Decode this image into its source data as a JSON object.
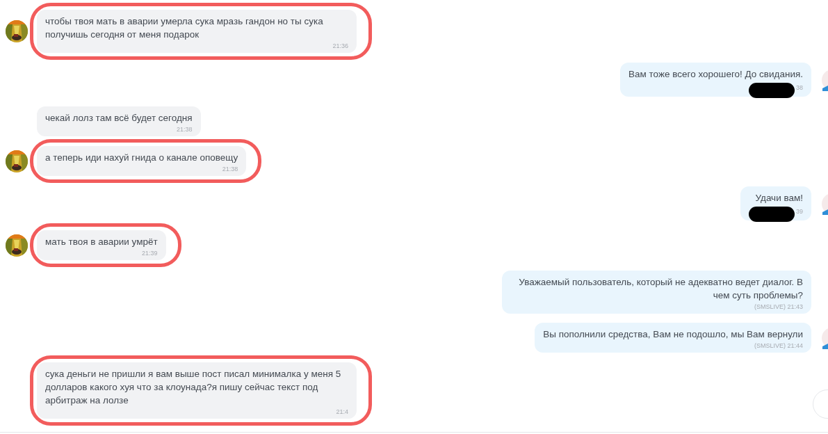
{
  "messages": [
    {
      "kind": "in",
      "avatar": true,
      "highlighted": true,
      "text": "чтобы твоя мать в аварии умерла сука мразь гандон но ты сука получишь сегодня от меня подарок",
      "time": "21:36",
      "redacted": false
    },
    {
      "kind": "out",
      "avatar": true,
      "highlighted": false,
      "text": "Вам тоже всего хорошего! До свидания.",
      "time": "38",
      "redacted": true
    },
    {
      "kind": "in",
      "avatar": false,
      "highlighted": false,
      "text": "чекай лолз там всё будет сегодня",
      "time": "21:38",
      "redacted": false
    },
    {
      "kind": "in",
      "avatar": true,
      "highlighted": true,
      "text": "а теперь иди нахуй гнида о канале оповещу",
      "time": "21:38",
      "redacted": false
    },
    {
      "kind": "out",
      "avatar": true,
      "highlighted": false,
      "text": "Удачи вам!",
      "time": "39",
      "redacted": true
    },
    {
      "kind": "in",
      "avatar": true,
      "highlighted": true,
      "text": "мать твоя в аварии умрёт",
      "time": "21:39",
      "redacted": false
    },
    {
      "kind": "out",
      "avatar": false,
      "highlighted": false,
      "text": "Уважаемый пользователь, который не адекватно ведет диалог. В чем суть проблемы?",
      "time": "(SMSLIVE)  21:43",
      "redacted": false
    },
    {
      "kind": "out",
      "avatar": true,
      "highlighted": false,
      "text": "Вы пополнили средства, Вам не подошло, мы Вам вернули",
      "time": "(SMSLIVE)  21:44",
      "redacted": false
    },
    {
      "kind": "in",
      "avatar": false,
      "highlighted": true,
      "text": "сука деньги не пришли я вам выше пост писал минималка у меня 5 долларов какого хуя что за клоунада?я пишу сейчас текст под арбитраж на лолзе",
      "time": "21:4",
      "redacted": false
    }
  ]
}
